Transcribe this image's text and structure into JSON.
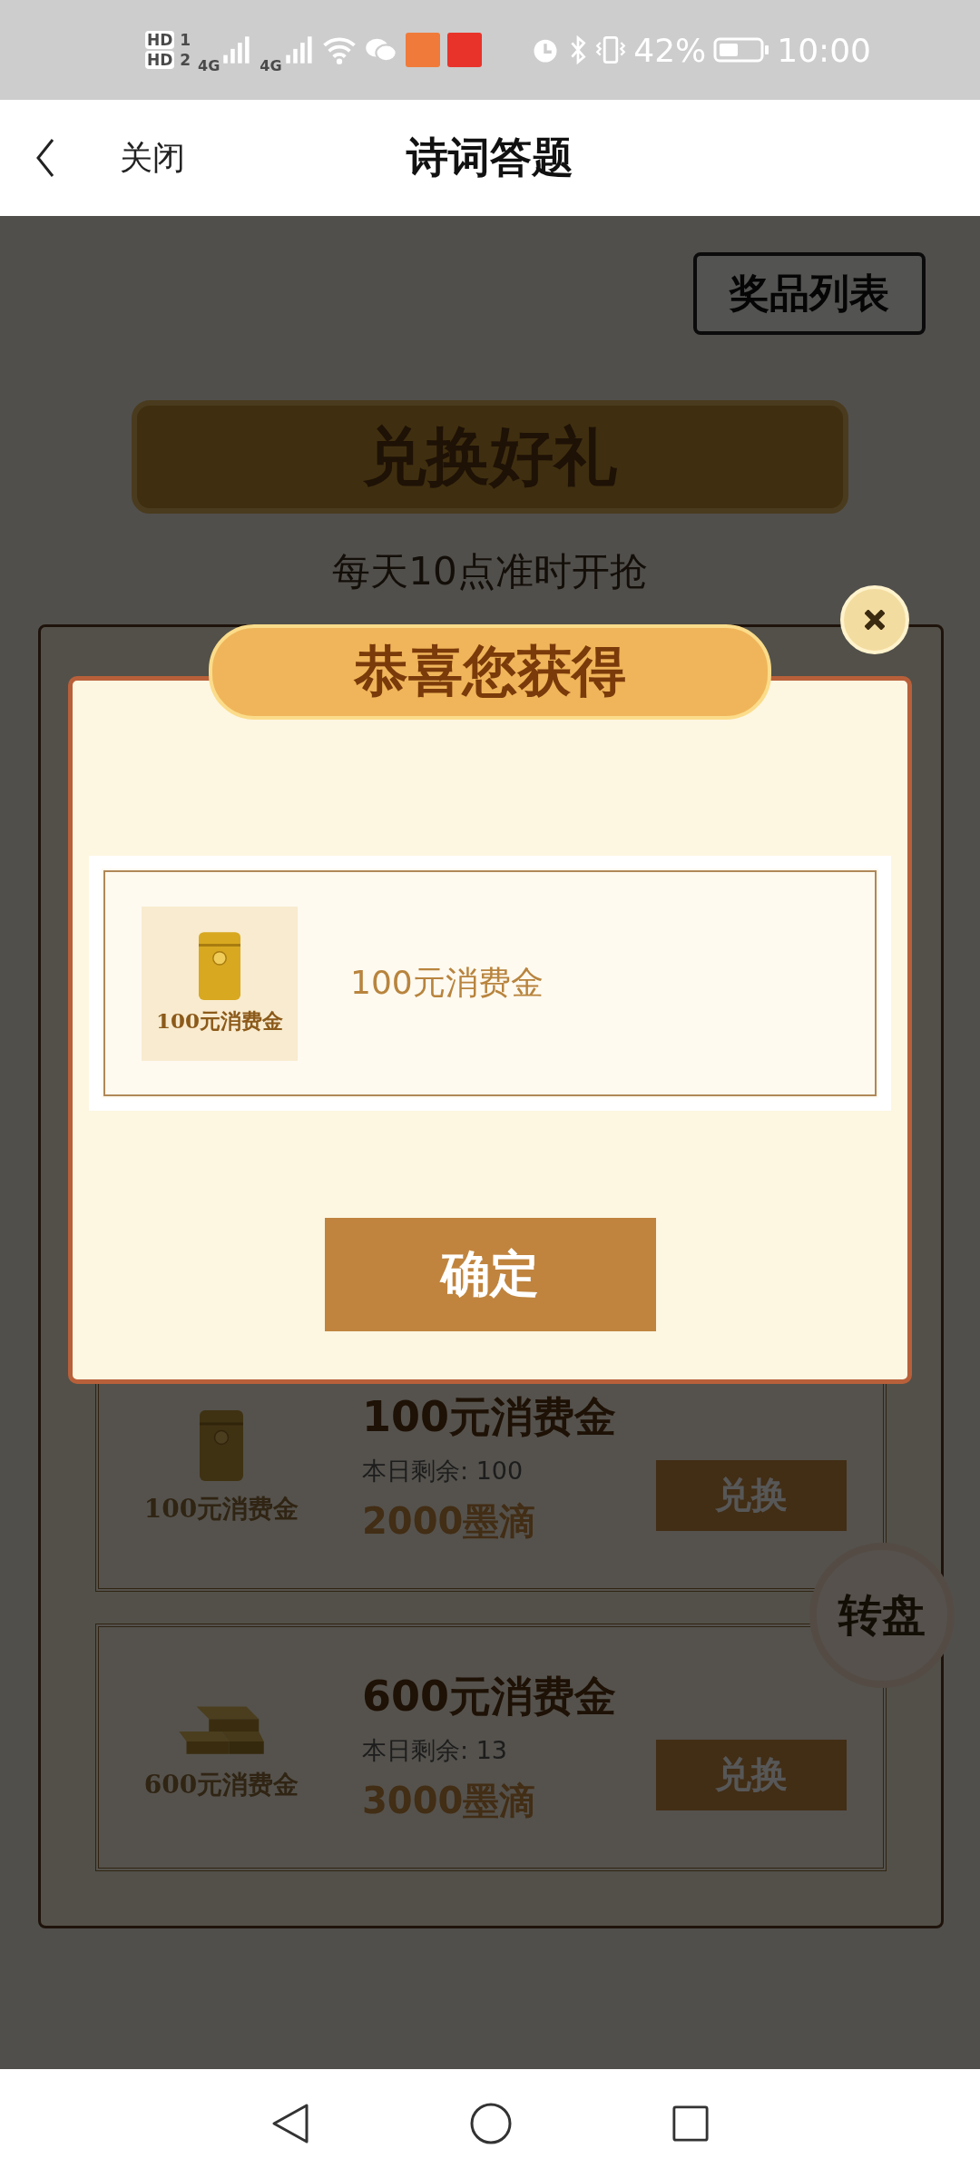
{
  "status_bar": {
    "sims": [
      {
        "hd": "HD",
        "slot": "1"
      },
      {
        "hd": "HD",
        "slot": "2"
      }
    ],
    "networks": [
      "4G",
      "4G"
    ],
    "battery": "42%",
    "time": "10:00"
  },
  "nav": {
    "close": "关闭",
    "title": "诗词答题"
  },
  "page": {
    "prize_list_button": "奖品列表",
    "banner": "兑换好礼",
    "subtitle": "每天10点准时开抢",
    "items": [
      {
        "kind": "envelope",
        "image_label": "100元消费金",
        "name": "100元消费金",
        "remaining": "本日剩余: 100",
        "price": "2000墨滴",
        "button": "兑换"
      },
      {
        "kind": "bars",
        "image_label": "600元消费金",
        "name": "600元消费金",
        "remaining": "本日剩余: 13",
        "price": "3000墨滴",
        "button": "兑换"
      }
    ],
    "wheel_button": "转盘"
  },
  "dialog": {
    "title": "恭喜您获得",
    "prize": {
      "kind": "envelope",
      "image_label": "100元消费金",
      "name": "100元消费金"
    },
    "confirm": "确定"
  }
}
